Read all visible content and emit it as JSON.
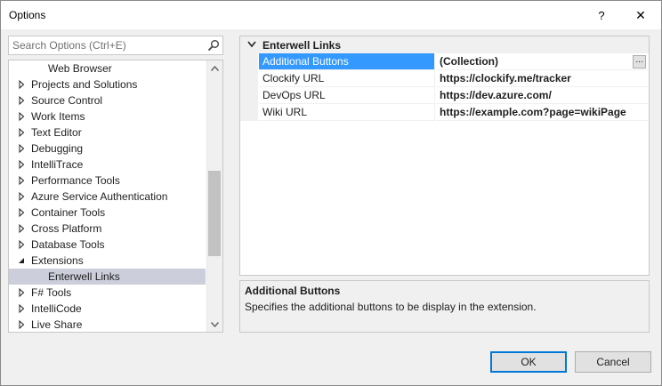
{
  "window": {
    "title": "Options",
    "help_label": "?",
    "close_label": "✕"
  },
  "search": {
    "placeholder": "Search Options (Ctrl+E)"
  },
  "tree": {
    "items": [
      {
        "label": "Web Browser",
        "indent": "child",
        "arrow": "none"
      },
      {
        "label": "Projects and Solutions",
        "indent": "top",
        "arrow": "collapsed"
      },
      {
        "label": "Source Control",
        "indent": "top",
        "arrow": "collapsed"
      },
      {
        "label": "Work Items",
        "indent": "top",
        "arrow": "collapsed"
      },
      {
        "label": "Text Editor",
        "indent": "top",
        "arrow": "collapsed"
      },
      {
        "label": "Debugging",
        "indent": "top",
        "arrow": "collapsed"
      },
      {
        "label": "IntelliTrace",
        "indent": "top",
        "arrow": "collapsed"
      },
      {
        "label": "Performance Tools",
        "indent": "top",
        "arrow": "collapsed"
      },
      {
        "label": "Azure Service Authentication",
        "indent": "top",
        "arrow": "collapsed"
      },
      {
        "label": "Container Tools",
        "indent": "top",
        "arrow": "collapsed"
      },
      {
        "label": "Cross Platform",
        "indent": "top",
        "arrow": "collapsed"
      },
      {
        "label": "Database Tools",
        "indent": "top",
        "arrow": "collapsed"
      },
      {
        "label": "Extensions",
        "indent": "top",
        "arrow": "expanded"
      },
      {
        "label": "Enterwell Links",
        "indent": "child",
        "arrow": "none",
        "selected": true
      },
      {
        "label": "F# Tools",
        "indent": "top",
        "arrow": "collapsed"
      },
      {
        "label": "IntelliCode",
        "indent": "top",
        "arrow": "collapsed"
      },
      {
        "label": "Live Share",
        "indent": "top",
        "arrow": "collapsed"
      }
    ]
  },
  "propgrid": {
    "category": "Enterwell Links",
    "rows": [
      {
        "name": "Additional Buttons",
        "value": "(Collection)",
        "selected": true,
        "ellipsis": "..."
      },
      {
        "name": "Clockify URL",
        "value": "https://clockify.me/tracker"
      },
      {
        "name": "DevOps URL",
        "value": "https://dev.azure.com/"
      },
      {
        "name": "Wiki URL",
        "value": "https://example.com?page=wikiPage"
      }
    ]
  },
  "description": {
    "title": "Additional Buttons",
    "text": "Specifies the additional buttons to be display in the extension."
  },
  "buttons": {
    "ok": "OK",
    "cancel": "Cancel"
  },
  "colors": {
    "selected_row": "#3399ff",
    "tree_selected": "#cccedb",
    "default_button_border": "#0078d7"
  }
}
